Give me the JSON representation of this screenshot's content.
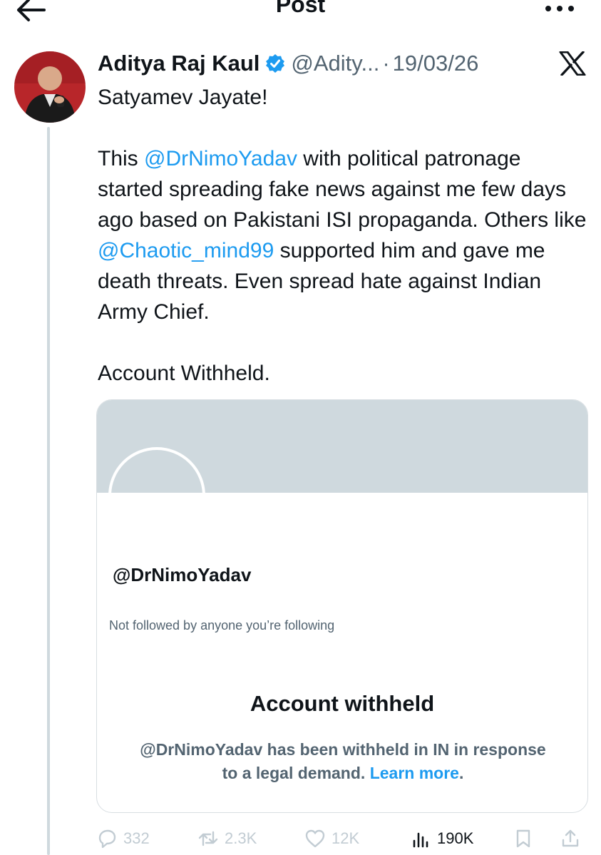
{
  "header": {
    "title": "Post",
    "back_icon": "arrow-left-icon",
    "more_icon": "more-horizontal-icon"
  },
  "post": {
    "author_name": "Aditya Raj Kaul",
    "handle": "@Adity...",
    "separator": "·",
    "date": "19/03/26",
    "platform_icon": "x-logo-icon",
    "text": {
      "line1": "Satyamev Jayate!",
      "p2_before": "This ",
      "mention1": "@DrNimoYadav",
      "p2_middle": " with political patronage started spreading fake news against me few days ago based on Pakistani ISI propaganda. Others like ",
      "mention2": "@Chaotic_mind99",
      "p2_after": " supported him and gave me death threats. Even spread hate against Indian Army Chief.",
      "line3": "Account Withheld."
    }
  },
  "card": {
    "handle": "@DrNimoYadav",
    "follow_status": "Not followed by anyone you’re following",
    "withheld_title": "Account withheld",
    "withheld_desc": "@DrNimoYadav has been withheld in IN in response to a legal demand.",
    "learn_more": "Learn more",
    "period": "."
  },
  "actions": {
    "replies": "332",
    "reposts": "2.3K",
    "likes": "12K",
    "views": "190K"
  },
  "colors": {
    "accent": "#1d9bf0",
    "secondary_text": "#536471",
    "banner": "#cfd9de"
  }
}
